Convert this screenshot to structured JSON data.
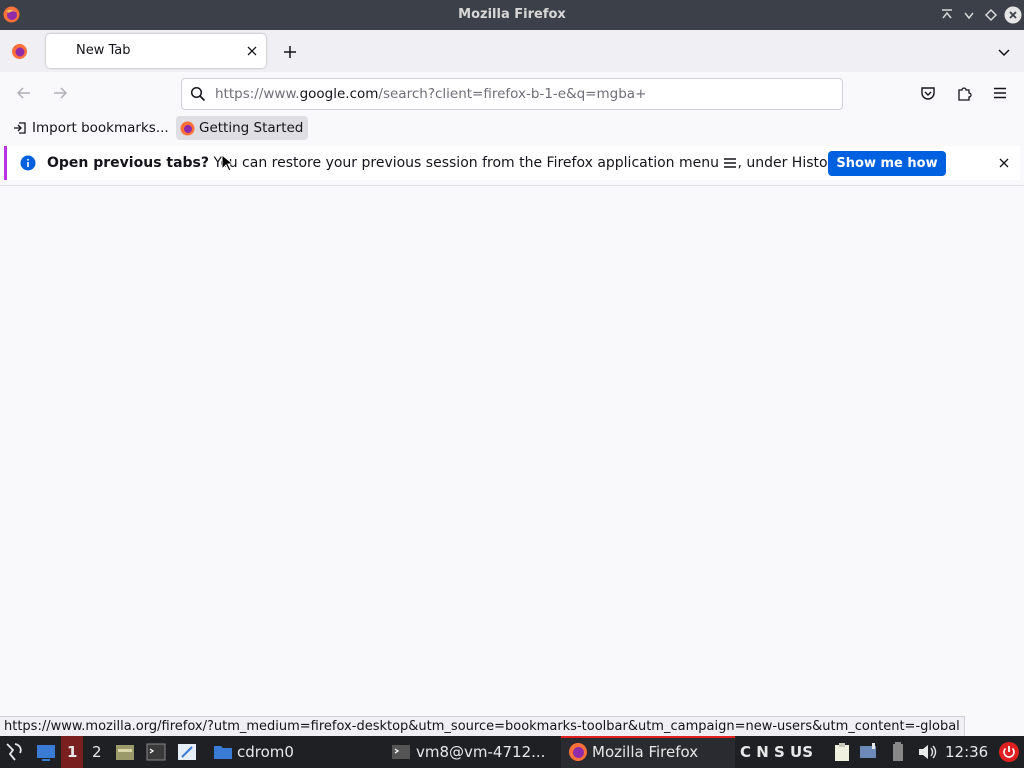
{
  "window": {
    "title": "Mozilla Firefox"
  },
  "tabs": [
    {
      "label": "New Tab",
      "active": true
    }
  ],
  "navbar": {
    "url_prefix": "https://www.",
    "url_domain": "google.com",
    "url_rest": "/search?client=firefox-b-1-e&q=mgba+"
  },
  "bookmarks": {
    "import_label": "Import bookmarks...",
    "getting_started_label": "Getting Started"
  },
  "notification": {
    "bold": "Open previous tabs?",
    "text": " You can restore your previous session from the Firefox application menu ",
    "text_after": ", under History.",
    "button_label": "Show me how"
  },
  "status_url": "https://www.mozilla.org/firefox/?utm_medium=firefox-desktop&utm_source=bookmarks-toolbar&utm_campaign=new-users&utm_content=-global",
  "taskbar": {
    "workspace_1": "1",
    "workspace_2": "2",
    "cdrom_label": "cdrom0",
    "terminal_label": "vm8@vm-4712...",
    "firefox_label": "Mozilla Firefox",
    "tray_letters": "C N S US",
    "clock": "12:36"
  },
  "colors": {
    "accent": "#0061e0",
    "notice_bar": "#b833e1",
    "power": "#e02020"
  }
}
